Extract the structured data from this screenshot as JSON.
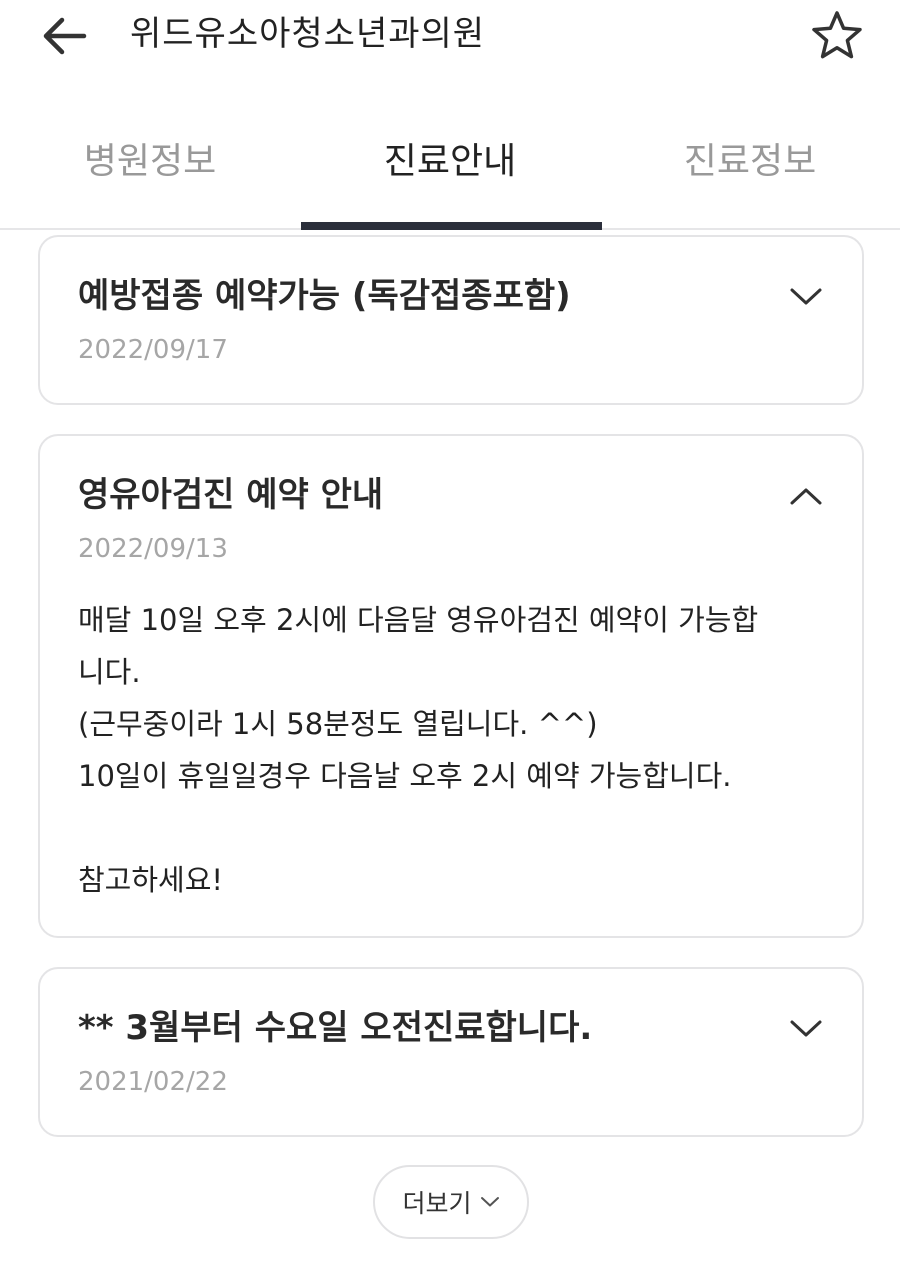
{
  "header": {
    "title": "위드유소아청소년과의원",
    "back_icon": "arrow-left-icon",
    "favorite_icon": "star-outline-icon"
  },
  "tabs": [
    {
      "label": "병원정보",
      "active": false
    },
    {
      "label": "진료안내",
      "active": true
    },
    {
      "label": "진료정보",
      "active": false
    }
  ],
  "notices": [
    {
      "title": "예방접종 예약가능 (독감접종포함)",
      "date": "2022/09/17",
      "expanded": false,
      "chevron_icon": "chevron-down-icon"
    },
    {
      "title": "영유아검진 예약 안내",
      "date": "2022/09/13",
      "expanded": true,
      "chevron_icon": "chevron-up-icon",
      "body": [
        "매달 10일 오후 2시에 다음달 영유아검진 예약이 가능합",
        "니다.",
        "(근무중이라 1시 58분정도 열립니다. ^^)",
        "10일이 휴일일경우 다음날 오후 2시 예약 가능합니다.",
        "",
        "참고하세요!"
      ]
    },
    {
      "title": "** 3월부터 수요일 오전진료합니다.",
      "date": "2021/02/22",
      "expanded": false,
      "chevron_icon": "chevron-down-icon"
    }
  ],
  "more_button": {
    "label": "더보기",
    "icon": "chevron-down-icon"
  },
  "colors": {
    "text_primary": "#222222",
    "text_muted": "#999999",
    "date": "#a6a6a6",
    "tab_indicator": "#2b2f3b",
    "card_border": "#e4e4e6"
  }
}
